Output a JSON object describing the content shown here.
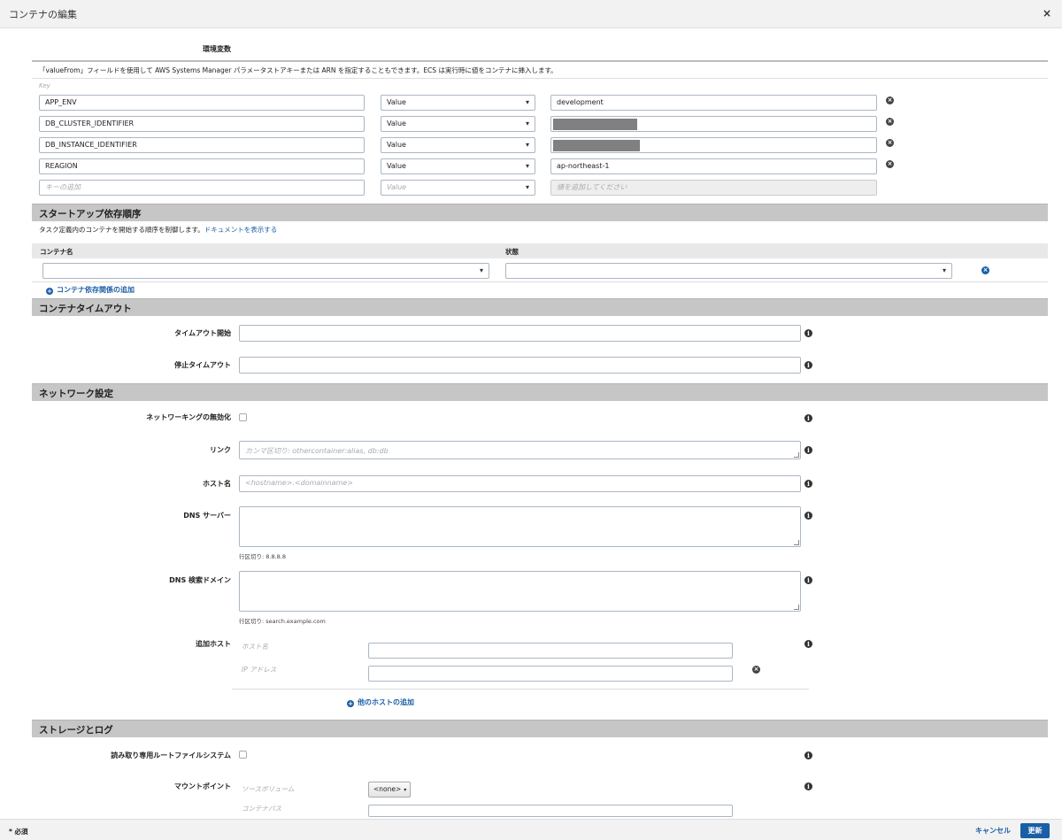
{
  "dialog": {
    "title": "コンテナの編集",
    "close": "×"
  },
  "env": {
    "heading": "環境変数",
    "description": "「valueFrom」フィールドを使用して AWS Systems Manager パラメータストアキーまたは ARN を指定することもできます。ECS は実行時に値をコンテナに挿入します。",
    "key_column": "Key",
    "rows": [
      {
        "key": "APP_ENV",
        "type": "Value",
        "value": "development",
        "redacted": false
      },
      {
        "key": "DB_CLUSTER_IDENTIFIER",
        "type": "Value",
        "value": "",
        "redacted": true
      },
      {
        "key": "DB_INSTANCE_IDENTIFIER",
        "type": "Value",
        "value": "",
        "redacted": true
      },
      {
        "key": "REAGION",
        "type": "Value",
        "value": "ap-northeast-1",
        "redacted": false
      }
    ],
    "new_row": {
      "key_placeholder": "キーの追加",
      "type_placeholder": "Value",
      "value_placeholder": "値を追加してください"
    }
  },
  "startup": {
    "heading": "スタートアップ依存順序",
    "description": "タスク定義内のコンテナを開始する順序を制御します。",
    "doc_link": "ドキュメントを表示する",
    "col_container": "コンテナ名",
    "col_state": "状態",
    "add_link": "コンテナ依存関係の追加"
  },
  "timeout": {
    "heading": "コンテナタイムアウト",
    "start_label": "タイムアウト開始",
    "stop_label": "停止タイムアウト"
  },
  "network": {
    "heading": "ネットワーク設定",
    "disable_label": "ネットワーキングの無効化",
    "links_label": "リンク",
    "links_placeholder": "カンマ区切り: othercontainer:alias, db:db",
    "hostname_label": "ホスト名",
    "hostname_placeholder": "<hostname>.<domainname>",
    "dns_label": "DNS サーバー",
    "dns_hint": "行区切り: 8.8.8.8",
    "dns_search_label": "DNS 検索ドメイン",
    "dns_search_hint": "行区切り: search.example.com",
    "extra_hosts_label": "追加ホスト",
    "host_sub": "ホスト名",
    "ip_sub": "IP アドレス",
    "add_host_link": "他のホストの追加"
  },
  "storage": {
    "heading": "ストレージとログ",
    "readonly_label": "読み取り専用ルートファイルシステム",
    "mount_label": "マウントポイント",
    "source_volume": "ソースボリューム",
    "none_option": "<none>",
    "container_path": "コンテナパス"
  },
  "footer": {
    "required": "* 必須",
    "cancel": "キャンセル",
    "update": "更新"
  },
  "icons": {
    "info": "i",
    "remove": "x",
    "plus": "+",
    "caret": "▾"
  }
}
